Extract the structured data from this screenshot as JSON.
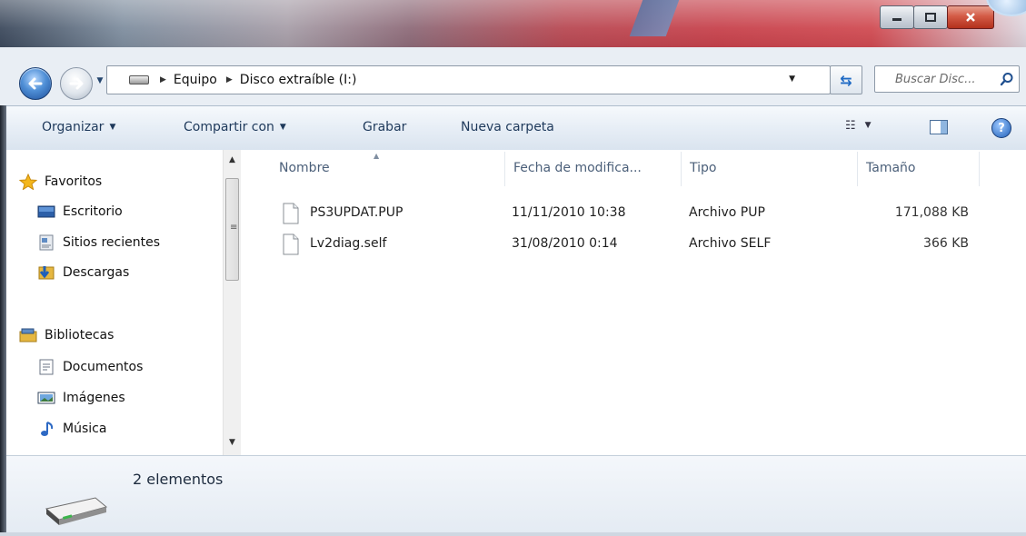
{
  "window": {
    "controls": {
      "minimize_icon": "minimize-icon",
      "maximize_icon": "maximize-icon",
      "close_icon": "close-icon"
    }
  },
  "address": {
    "breadcrumbs": [
      "Equipo",
      "Disco extraíble (I:)"
    ],
    "search_placeholder": "Buscar Disc..."
  },
  "toolbar": {
    "organize": "Organizar",
    "share": "Compartir con",
    "burn": "Grabar",
    "new_folder": "Nueva carpeta"
  },
  "sidebar": {
    "favorites": {
      "label": "Favoritos",
      "items": [
        {
          "label": "Escritorio",
          "icon": "desktop-icon"
        },
        {
          "label": "Sitios recientes",
          "icon": "recent-places-icon"
        },
        {
          "label": "Descargas",
          "icon": "downloads-icon"
        }
      ]
    },
    "libraries": {
      "label": "Bibliotecas",
      "items": [
        {
          "label": "Documentos",
          "icon": "documents-icon"
        },
        {
          "label": "Imágenes",
          "icon": "pictures-icon"
        },
        {
          "label": "Música",
          "icon": "music-icon"
        }
      ]
    }
  },
  "files": {
    "columns": [
      "Nombre",
      "Fecha de modifica...",
      "Tipo",
      "Tamaño"
    ],
    "rows": [
      {
        "name": "PS3UPDAT.PUP",
        "date": "11/11/2010 10:38",
        "type": "Archivo PUP",
        "size": "171,088 KB"
      },
      {
        "name": "Lv2diag.self",
        "date": "31/08/2010 0:14",
        "type": "Archivo SELF",
        "size": "366 KB"
      }
    ]
  },
  "status": {
    "count": "2 elementos"
  },
  "colors": {
    "accent": "#1e395b",
    "header_text": "#4c607a",
    "title_red": "#c7424c"
  }
}
